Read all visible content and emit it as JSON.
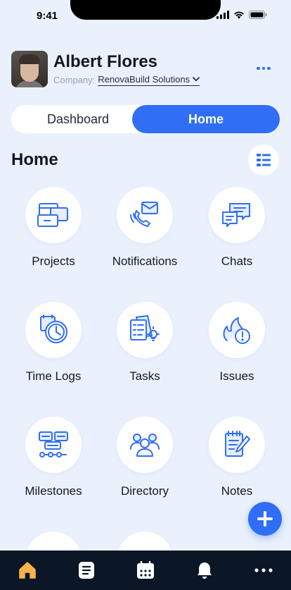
{
  "status_bar": {
    "time": "9:41"
  },
  "user": {
    "name": "Albert Flores",
    "company_label": "Company:",
    "company_name": "RenovaBuild Solutions"
  },
  "segmented": {
    "tabs": [
      "Dashboard",
      "Home"
    ],
    "active": "Home"
  },
  "section": {
    "title": "Home"
  },
  "modules": [
    {
      "label": "Projects",
      "icon": "projects-icon"
    },
    {
      "label": "Notifications",
      "icon": "notifications-icon"
    },
    {
      "label": "Chats",
      "icon": "chats-icon"
    },
    {
      "label": "Time Logs",
      "icon": "time-logs-icon"
    },
    {
      "label": "Tasks",
      "icon": "tasks-icon"
    },
    {
      "label": "Issues",
      "icon": "issues-icon"
    },
    {
      "label": "Milestones",
      "icon": "milestones-icon"
    },
    {
      "label": "Directory",
      "icon": "directory-icon"
    },
    {
      "label": "Notes",
      "icon": "notes-icon"
    }
  ],
  "tab_bar": [
    "home-icon",
    "documents-icon",
    "calendar-icon",
    "bell-icon",
    "more-icon"
  ],
  "colors": {
    "accent": "#2f6ef5",
    "background": "#eaf1fc",
    "tab_bar": "#0b1627",
    "active_tab_icon": "#f7b34a"
  }
}
